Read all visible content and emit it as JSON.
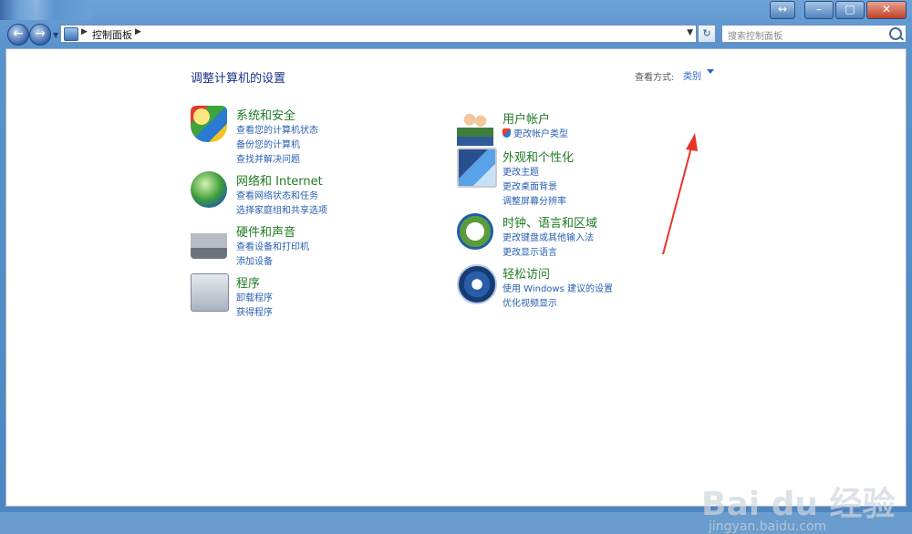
{
  "window": {
    "caption_buttons": [
      "↔",
      "–",
      "□",
      "✕"
    ]
  },
  "address_bar": {
    "breadcrumb": "控制面板",
    "search_placeholder": "搜索控制面板"
  },
  "page": {
    "title": "调整计算机的设置",
    "view_by_label": "查看方式:",
    "view_by_value": "类别"
  },
  "categories_left": [
    {
      "title": "系统和安全",
      "icon": "shield-icon",
      "links": [
        "查看您的计算机状态",
        "备份您的计算机",
        "查找并解决问题"
      ]
    },
    {
      "title": "网络和 Internet",
      "icon": "network-globe-icon",
      "links": [
        "查看网络状态和任务",
        "选择家庭组和共享选项"
      ]
    },
    {
      "title": "硬件和声音",
      "icon": "printer-icon",
      "links": [
        "查看设备和打印机",
        "添加设备"
      ]
    },
    {
      "title": "程序",
      "icon": "programs-icon",
      "links": [
        "卸载程序",
        "获得程序"
      ]
    }
  ],
  "categories_right": [
    {
      "title": "用户帐户",
      "icon": "users-icon",
      "links": [
        "更改帐户类型"
      ]
    },
    {
      "title": "外观和个性化",
      "icon": "monitor-icon",
      "links": [
        "更改主题",
        "更改桌面背景",
        "调整屏幕分辨率"
      ]
    },
    {
      "title": "时钟、语言和区域",
      "icon": "clock-globe-icon",
      "links": [
        "更改键盘或其他输入法",
        "更改显示语言"
      ]
    },
    {
      "title": "轻松访问",
      "icon": "accessibility-icon",
      "links": [
        "使用 Windows 建议的设置",
        "优化视频显示"
      ]
    }
  ],
  "watermark": {
    "text": "Bai du 经验",
    "sub": "jingyan.baidu.com"
  },
  "colors": {
    "link": "#2a5fb0",
    "category_title": "#1f7a23",
    "page_title": "#1e3287",
    "annotation_arrow": "#e8342a"
  }
}
